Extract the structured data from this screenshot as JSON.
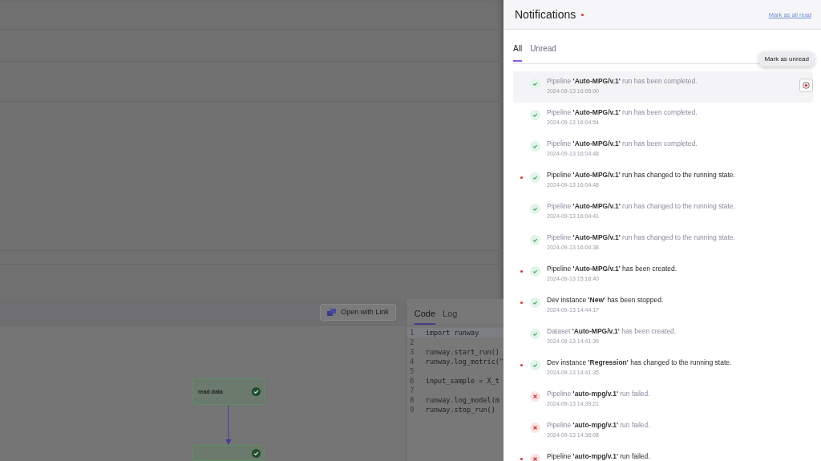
{
  "app": {
    "toolbar_button": "Open with Link",
    "code_tabs": [
      {
        "label": "Code",
        "selected": true
      },
      {
        "label": "Log",
        "selected": false
      }
    ],
    "code_lines": [
      {
        "number": "1",
        "text": "import runway",
        "highlighted": true
      },
      {
        "number": "2",
        "highlighted": false
      },
      {
        "number": "3",
        "text": "runway.start_run()",
        "highlighted": false
      },
      {
        "number": "4",
        "text": "runway.log_metric(\"",
        "highlighted": false
      },
      {
        "number": "5",
        "highlighted": false
      },
      {
        "number": "6",
        "text": "input_sample = X_t",
        "highlighted": false
      },
      {
        "number": "7",
        "highlighted": false
      },
      {
        "number": "8",
        "text": "runway.log_model(m",
        "highlighted": false
      },
      {
        "number": "9",
        "text": "runway.stop_run()",
        "highlighted": false
      }
    ],
    "nodes": [
      {
        "label": "read data",
        "done": true
      },
      {
        "done": true
      }
    ]
  },
  "notifications": {
    "title": "Notifications",
    "has_unread": true,
    "mark_all_link": "Mark as all read",
    "tabs": [
      {
        "label": "All",
        "selected": true
      },
      {
        "label": "Unread",
        "selected": false
      }
    ],
    "tooltip": "Mark as unread",
    "items": [
      {
        "text": "Pipeline **'Auto-MPG/v.1'** run has been completed.",
        "time": "2024-09-13 16:05:00",
        "kind": "success",
        "unread": false,
        "highlighted": true
      },
      {
        "text": "Pipeline **'Auto-MPG/v.1'** run has been completed.",
        "time": "2024-09-13 16:04:54",
        "kind": "success",
        "unread": false,
        "highlighted": false
      },
      {
        "text": "Pipeline **'Auto-MPG/v.1'** run has been completed.",
        "time": "2024-09-13 16:04:48",
        "kind": "success",
        "unread": false,
        "highlighted": false
      },
      {
        "text": "Pipeline **'Auto-MPG/v.1'** run has changed to the running state.",
        "time": "2024-09-13 16:04:48",
        "kind": "success",
        "unread": true,
        "highlighted": false
      },
      {
        "text": "Pipeline **'Auto-MPG/v.1'** run has changed to the running state.",
        "time": "2024-09-13 16:04:41",
        "kind": "success",
        "unread": false,
        "highlighted": false
      },
      {
        "text": "Pipeline **'Auto-MPG/v.1'** run has changed to the running state.",
        "time": "2024-09-13 16:04:38",
        "kind": "success",
        "unread": false,
        "highlighted": false
      },
      {
        "text": "Pipeline **'Auto-MPG/v.1'** has been created.",
        "time": "2024-09-13 15:16:40",
        "kind": "success",
        "unread": true,
        "highlighted": false
      },
      {
        "text": "Dev instance **'New'** has been stopped.",
        "time": "2024-09-13 14:44:17",
        "kind": "success",
        "unread": true,
        "highlighted": false
      },
      {
        "text": "Dataset **'Auto-MPG/v.1'** has been created.",
        "time": "2024-09-13 14:41:39",
        "kind": "success",
        "unread": false,
        "highlighted": false
      },
      {
        "text": "Dev instance **'Regression'** has changed to the running state.",
        "time": "2024-09-13 14:41:35",
        "kind": "success",
        "unread": true,
        "highlighted": false
      },
      {
        "text": "Pipeline **'auto-mpg/v.1'** run failed.",
        "time": "2024-09-13 14:39:21",
        "kind": "failed",
        "unread": false,
        "highlighted": false
      },
      {
        "text": "Pipeline **'auto-mpg/v.1'** run failed.",
        "time": "2024-09-13 14:38:08",
        "kind": "failed",
        "unread": false,
        "highlighted": false
      },
      {
        "text": "Pipeline **'auto-mpg/v.1'** run failed.",
        "kind": "failed",
        "unread": true,
        "highlighted": false
      }
    ]
  }
}
